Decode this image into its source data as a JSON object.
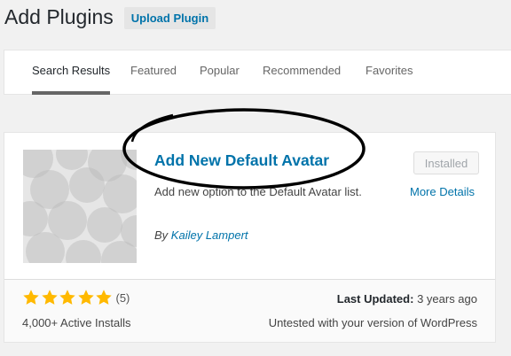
{
  "header": {
    "title": "Add Plugins",
    "upload_label": "Upload Plugin"
  },
  "filters": {
    "tabs": [
      {
        "label": "Search Results",
        "current": true
      },
      {
        "label": "Featured",
        "current": false
      },
      {
        "label": "Popular",
        "current": false
      },
      {
        "label": "Recommended",
        "current": false
      },
      {
        "label": "Favorites",
        "current": false
      }
    ]
  },
  "plugin": {
    "name": "Add New Default Avatar",
    "description": "Add new option to the Default Avatar list.",
    "author_prefix": "By",
    "author": "Kailey Lampert",
    "action_label": "Installed",
    "more_details_label": "More Details",
    "rating_stars": 5,
    "rating_count": "(5)",
    "active_installs": "4,000+ Active Installs",
    "last_updated_label": "Last Updated:",
    "last_updated_value": "3 years ago",
    "compatibility": "Untested with your version of WordPress"
  },
  "colors": {
    "link": "#0073aa",
    "star": "#ffb900",
    "background": "#f1f1f1"
  },
  "icons": [
    "star-filled-icon"
  ]
}
